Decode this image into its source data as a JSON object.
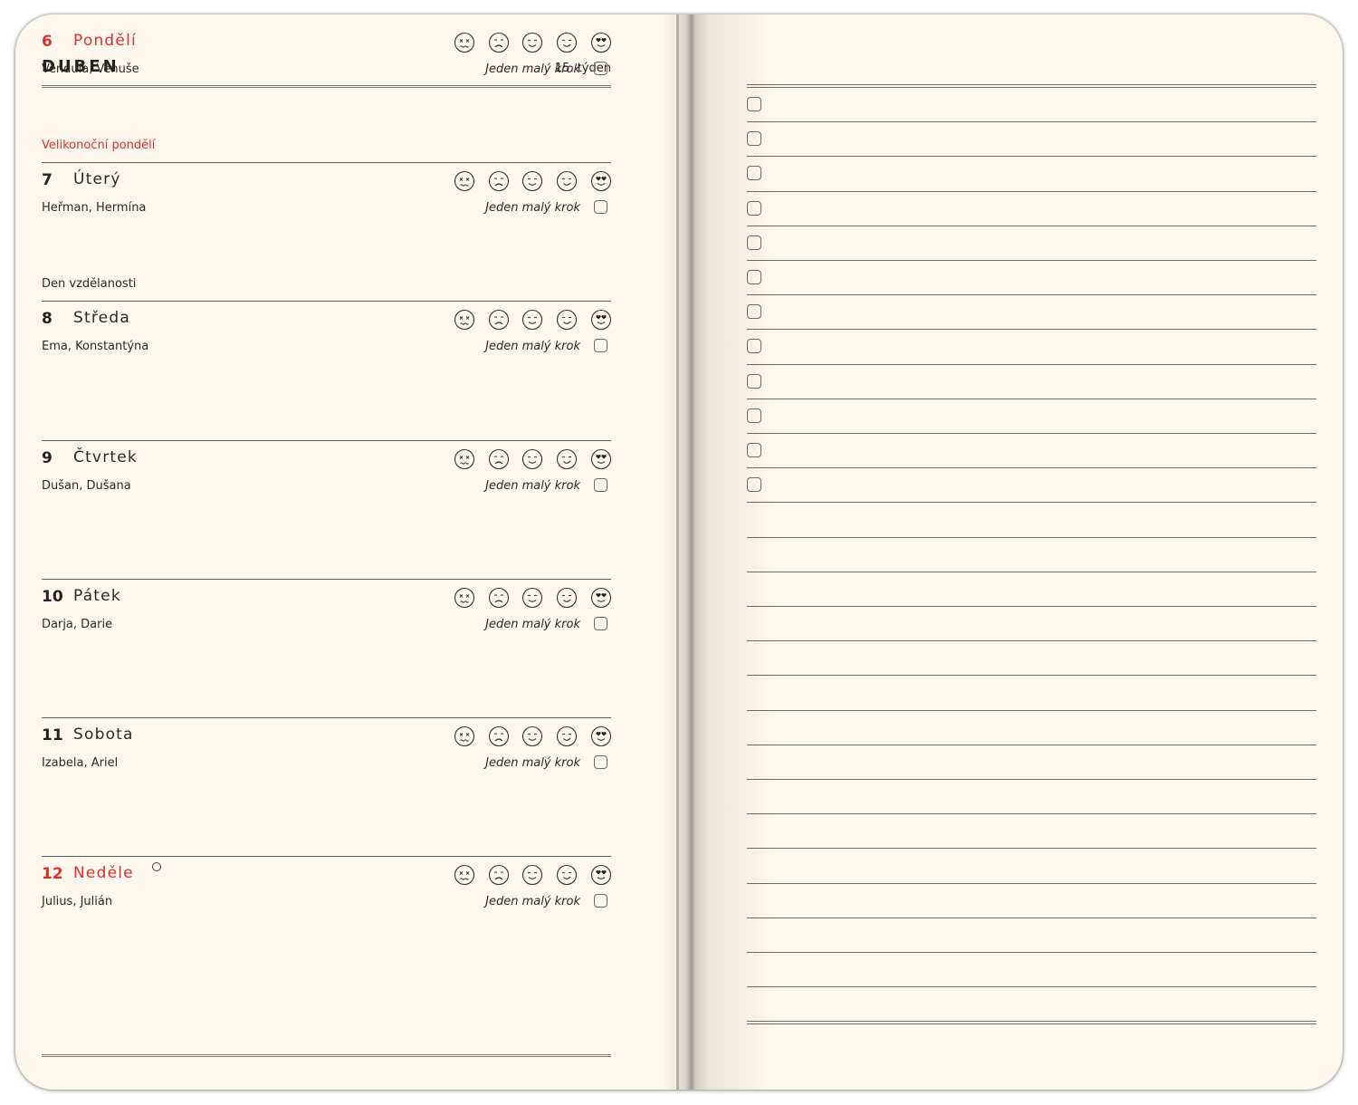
{
  "header": {
    "month": "DUBEN",
    "week": "15. týden"
  },
  "days": [
    {
      "num": "6",
      "name": "Pondělí",
      "names": "Vendula, Venuše",
      "step": "Jeden malý krok",
      "holiday": "Velikonoční pondělí",
      "red": true,
      "holiday_red": true,
      "moon": false
    },
    {
      "num": "7",
      "name": "Úterý",
      "names": "Heřman, Hermína",
      "step": "Jeden malý krok",
      "holiday": "Den vzdělanosti",
      "red": false,
      "holiday_red": false,
      "moon": false
    },
    {
      "num": "8",
      "name": "Středa",
      "names": "Ema, Konstantýna",
      "step": "Jeden malý krok",
      "holiday": "",
      "red": false,
      "holiday_red": false,
      "moon": false
    },
    {
      "num": "9",
      "name": "Čtvrtek",
      "names": "Dušan, Dušana",
      "step": "Jeden malý krok",
      "holiday": "",
      "red": false,
      "holiday_red": false,
      "moon": false
    },
    {
      "num": "10",
      "name": "Pátek",
      "names": "Darja, Darie",
      "step": "Jeden malý krok",
      "holiday": "",
      "red": false,
      "holiday_red": false,
      "moon": false
    },
    {
      "num": "11",
      "name": "Sobota",
      "names": "Izabela, Ariel",
      "step": "Jeden malý krok",
      "holiday": "",
      "red": false,
      "holiday_red": false,
      "moon": false
    },
    {
      "num": "12",
      "name": "Neděle",
      "names": "Julius, Julián",
      "step": "Jeden malý krok",
      "holiday": "",
      "red": true,
      "holiday_red": false,
      "moon": true
    }
  ],
  "moods": [
    "dizzy-face-icon",
    "sad-face-icon",
    "smile-face-icon",
    "wink-face-icon",
    "heart-eyes-face-icon"
  ],
  "notes": {
    "checkbox_rows": 12,
    "total_rows": 28
  },
  "colors": {
    "paper": "#fdf7ed",
    "accent_red": "#d9312c",
    "ink": "#2a2a2a"
  }
}
